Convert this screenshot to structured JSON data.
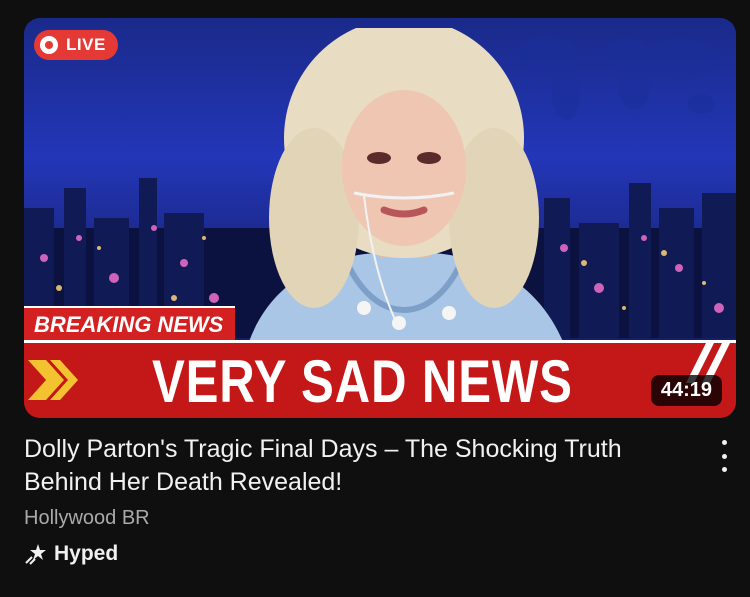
{
  "thumbnail": {
    "live_label": "LIVE",
    "breaking_label": "BREAKING",
    "breaking_news_word": "NEWS",
    "headline": "VERY SAD NEWS",
    "duration": "44:19"
  },
  "video": {
    "title": "Dolly Parton's Tragic Final Days – The Shocking Truth Behind Her Death Revealed!",
    "channel": "Hollywood BR",
    "badge": "Hyped"
  },
  "icons": {
    "more": "more-vertical-icon",
    "hyped": "hyped-rocket-icon"
  },
  "colors": {
    "background": "#0f0f0f",
    "banner_red": "#c41717",
    "live_red": "#e53935",
    "title_text": "#f1f1f1",
    "channel_text": "#aaaaaa"
  }
}
